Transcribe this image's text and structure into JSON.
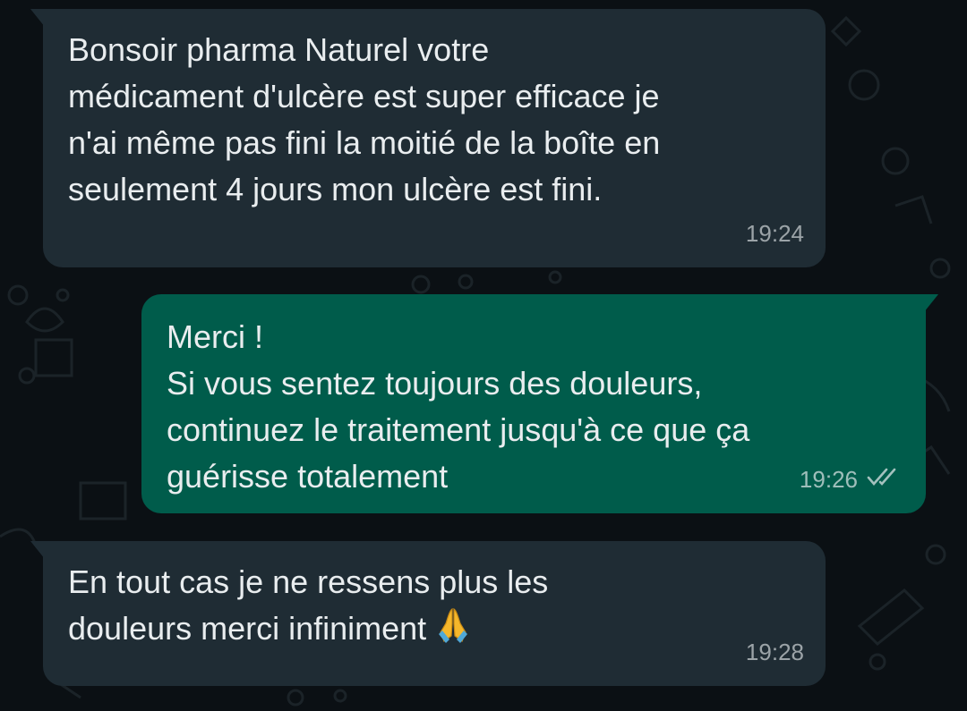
{
  "colors": {
    "background": "#0b1014",
    "incoming_bubble": "#1f2c34",
    "outgoing_bubble": "#005c4b",
    "text": "#e9edef",
    "timestamp": "#9ba5ab"
  },
  "messages": [
    {
      "direction": "incoming",
      "text": "Bonsoir pharma Naturel votre\nmédicament d'ulcère est super efficace je\nn'ai même pas fini la moitié de la boîte en\nseulement 4 jours mon ulcère est fini.",
      "time": "19:24"
    },
    {
      "direction": "outgoing",
      "text": "Merci !\nSi vous sentez toujours des douleurs,\ncontinuez le traitement jusqu'à ce que ça\nguérisse totalement",
      "time": "19:26",
      "status_icon": "double-check-read-icon"
    },
    {
      "direction": "incoming",
      "text": "En tout cas je ne ressens plus les\ndouleurs merci infiniment",
      "emoji_icon": "folded-hands-icon",
      "time": "19:28"
    }
  ]
}
